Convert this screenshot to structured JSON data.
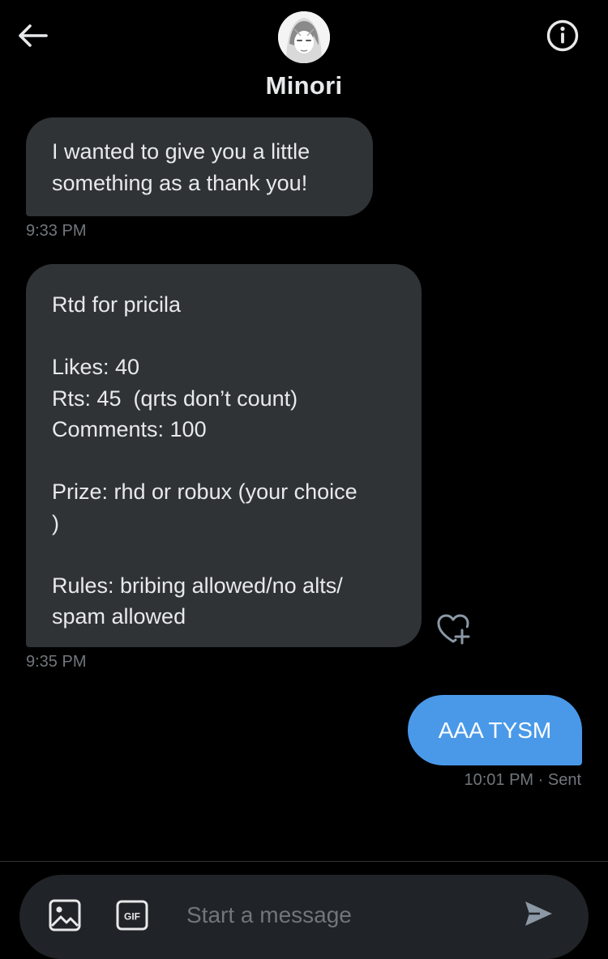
{
  "header": {
    "contact_name": "Minori",
    "back_icon": "arrow-left-icon",
    "info_icon": "info-icon"
  },
  "messages": [
    {
      "direction": "received",
      "text": "I wanted to give you a little\nsomething as a thank you!",
      "time": "9:33 PM"
    },
    {
      "direction": "received",
      "text": "Rtd for pricila\n\nLikes: 40\nRts: 45  (qrts don’t count)\nComments: 100\n\nPrize: rhd or robux (your choice\n)\n\nRules: bribing allowed/no alts/\nspam allowed",
      "time": "9:35 PM",
      "reaction_icon": "heart-plus-icon"
    },
    {
      "direction": "sent",
      "text": "AAA TYSM",
      "time": "10:01 PM",
      "status": "· Sent"
    }
  ],
  "composer": {
    "placeholder": "Start a message",
    "media_icon": "image-icon",
    "gif_icon": "gif-icon",
    "gif_label": "GIF",
    "send_icon": "send-icon"
  },
  "colors": {
    "background": "#000000",
    "bubble_received": "#2f3336",
    "bubble_sent": "#4a99e9",
    "muted_text": "#71767b",
    "primary_text": "#e7e9ea",
    "composer_bg": "#202327"
  }
}
